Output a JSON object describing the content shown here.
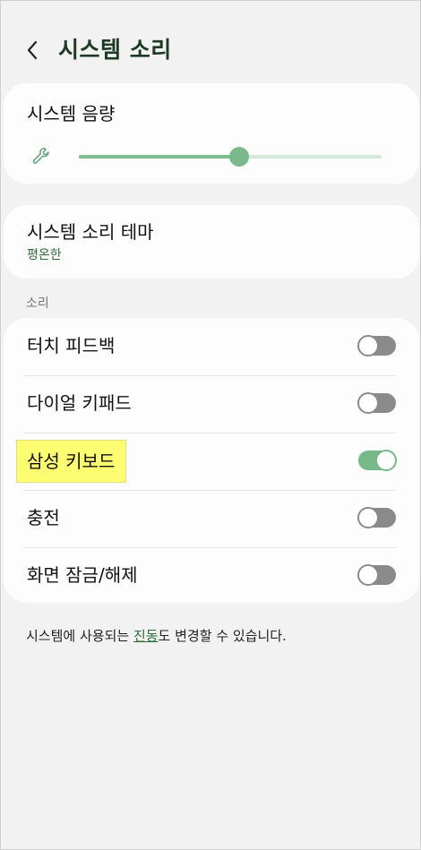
{
  "header": {
    "back_icon": "chevron-left-icon",
    "title": "시스템 소리"
  },
  "volume": {
    "title": "시스템 음량",
    "icon": "wrench-icon",
    "level": 0.53
  },
  "theme": {
    "title": "시스템 소리 테마",
    "value": "평온한"
  },
  "sound_section": {
    "label": "소리",
    "items": [
      {
        "label": "터치 피드백",
        "on": false
      },
      {
        "label": "다이얼 키패드",
        "on": false
      },
      {
        "label": "삼성 키보드",
        "on": true
      },
      {
        "label": "충전",
        "on": false
      },
      {
        "label": "화면 잠금/해제",
        "on": false
      }
    ]
  },
  "footer": {
    "prefix": "시스템에 사용되는 ",
    "link": "진동",
    "suffix": "도 변경할 수 있습니다."
  },
  "colors": {
    "accent": "#77b888",
    "title_green": "#1f3a24",
    "highlight": "#fcfd70"
  }
}
